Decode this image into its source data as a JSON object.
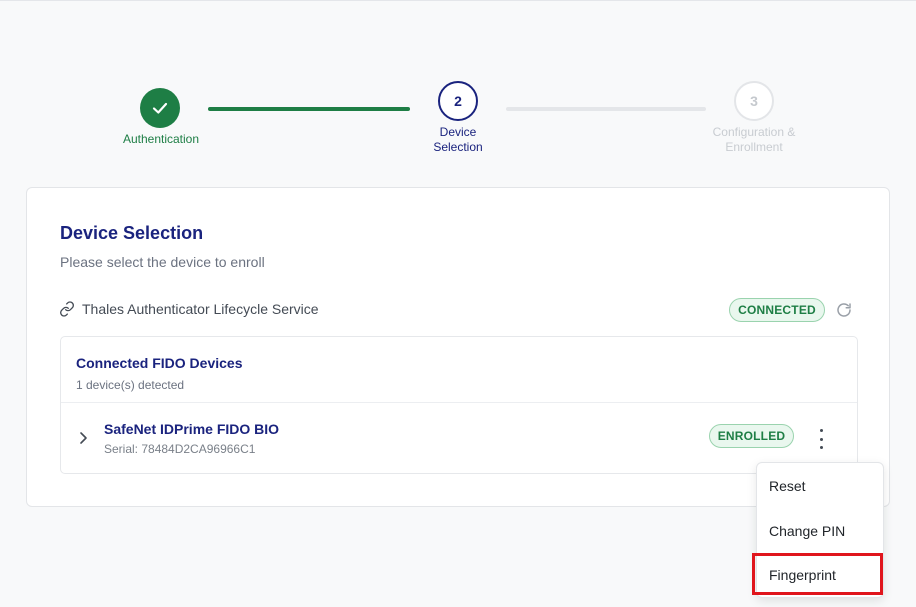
{
  "stepper": {
    "steps": [
      {
        "number": "",
        "label": "Authentication",
        "state": "completed"
      },
      {
        "number": "2",
        "label": "Device Selection",
        "state": "active"
      },
      {
        "number": "3",
        "label": "Configuration & Enrollment",
        "state": "pending"
      }
    ],
    "completed_icon": "check-icon"
  },
  "card": {
    "title": "Device Selection",
    "subtitle": "Please select the device to enroll",
    "service": {
      "icon": "link-icon",
      "label": "Thales Authenticator Lifecycle Service",
      "status": "CONNECTED",
      "refresh_icon": "refresh-icon"
    },
    "devices_panel": {
      "title": "Connected FIDO Devices",
      "count_text": "1 device(s) detected",
      "devices": [
        {
          "name": "SafeNet IDPrime FIDO BIO",
          "serial": "Serial: 78484D2CA96966C1",
          "status": "ENROLLED",
          "expand_icon": "chevron-right-icon",
          "menu_icon": "more-vertical-icon"
        }
      ]
    }
  },
  "menu": {
    "items": [
      {
        "label": "Reset"
      },
      {
        "label": "Change PIN"
      },
      {
        "label": "Fingerprint",
        "highlighted": true
      }
    ]
  },
  "colors": {
    "primary": "#1a237e",
    "success": "#1e7e45",
    "success_bg": "#e9f7ee",
    "highlight": "#e0151c",
    "muted": "#6b7280"
  }
}
